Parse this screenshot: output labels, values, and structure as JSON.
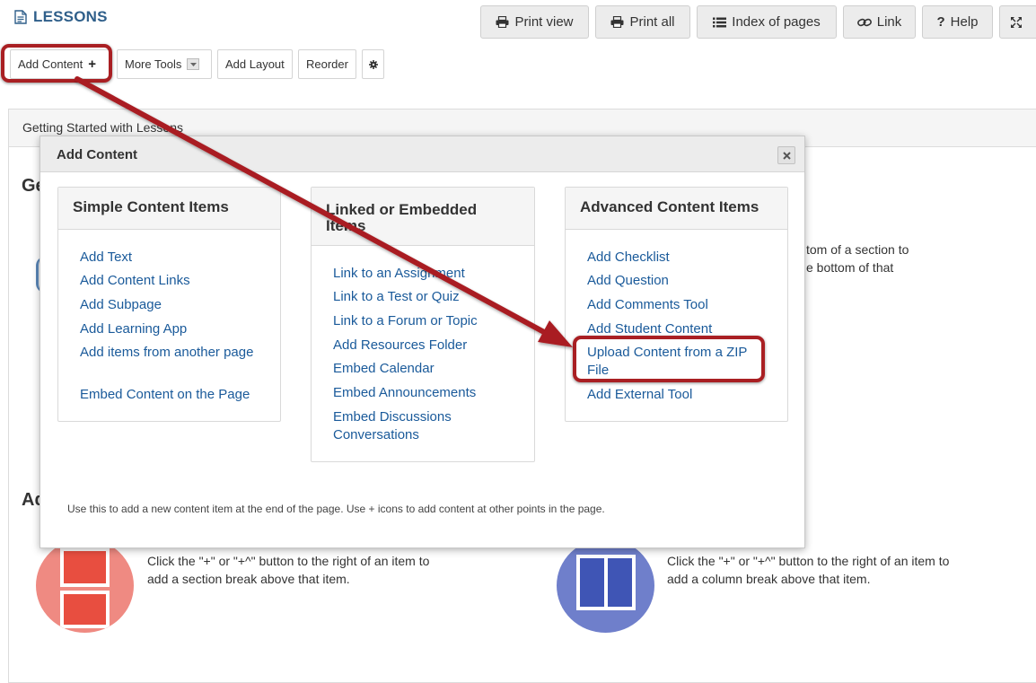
{
  "header": {
    "title": "LESSONS",
    "buttons": {
      "print_view": "Print view",
      "print_all": "Print all",
      "index_of_pages": "Index of pages",
      "link": "Link",
      "help": "Help"
    }
  },
  "toolbar": {
    "add_content": "Add Content",
    "more_tools": "More Tools",
    "add_layout": "Add Layout",
    "reorder": "Reorder"
  },
  "page": {
    "panel_title": "Getting Started with Lessons",
    "heading_1": "Ge",
    "heading_2": "Ad",
    "partial_text_1": "tom of a section to",
    "partial_text_2": "e bottom of that",
    "section_break_text": "Click the \"+\" or \"+^\" button to the right of an item to add a section break above that item.",
    "column_break_text": "Click the \"+\" or \"+^\" button to the right of an item to add a column break above that item."
  },
  "modal": {
    "title": "Add Content",
    "note": "Use this to add a new content item at the end of the page. Use + icons to add content at other points in the page.",
    "columns": [
      {
        "title": "Simple Content Items",
        "items": [
          "Add Text",
          "Add Content Links",
          "Add Subpage",
          "Add Learning App",
          "Add items from another page",
          "Embed Content on the Page"
        ]
      },
      {
        "title": "Linked or Embedded Items",
        "items": [
          "Link to an Assignment",
          "Link to a Test or Quiz",
          "Link to a Forum or Topic",
          "Add Resources Folder",
          "Embed Calendar",
          "Embed Announcements",
          "Embed Discussions Conversations"
        ]
      },
      {
        "title": "Advanced Content Items",
        "items": [
          "Add Checklist",
          "Add Question",
          "Add Comments Tool",
          "Add Student Content",
          "Upload Content from a ZIP File",
          "Add External Tool"
        ]
      }
    ]
  },
  "colors": {
    "title_blue": "#2f5f8a",
    "link_blue": "#1a5a9a",
    "highlight_red": "#a91f23",
    "section_icon_circle": "#ef8a82",
    "column_icon_circle": "#6f7fcb"
  }
}
